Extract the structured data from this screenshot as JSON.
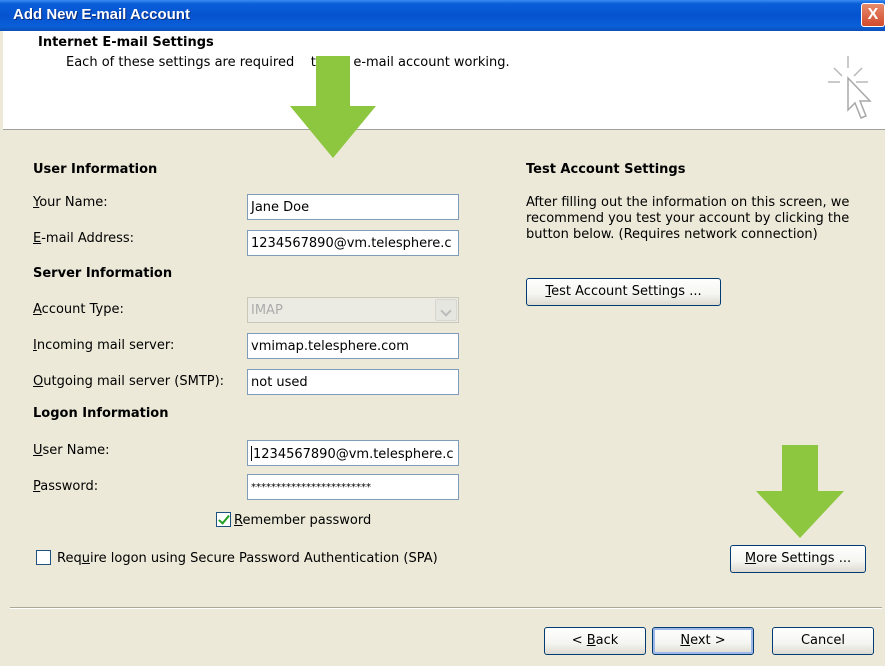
{
  "window": {
    "title": "Add New E-mail Account",
    "close_glyph": "X"
  },
  "header": {
    "title": "Internet E-mail Settings",
    "description": "Each of these settings are required    t your e-mail account working."
  },
  "user_info": {
    "heading": "User Information",
    "your_name_label": "our Name:",
    "your_name_label_key": "Y",
    "your_name_value": "Jane Doe",
    "email_label_key": "E",
    "email_label": "-mail Address:",
    "email_value": "1234567890@vm.telesphere.c"
  },
  "server_info": {
    "heading": "Server Information",
    "account_type_label_key": "A",
    "account_type_label": "ccount Type:",
    "account_type_value": "IMAP",
    "incoming_label_key": "I",
    "incoming_label": "ncoming mail server:",
    "incoming_value": "vmimap.telesphere.com",
    "outgoing_label_key": "O",
    "outgoing_label": "utgoing mail server (SMTP):",
    "outgoing_value": "not used"
  },
  "logon_info": {
    "heading": "Logon Information",
    "username_label_key": "U",
    "username_label": "ser Name:",
    "username_value": "1234567890@vm.telesphere.c",
    "password_label_key": "P",
    "password_label": "assword:",
    "password_value": "************************",
    "remember_label_key": "R",
    "remember_label": "emember password",
    "remember_checked": true,
    "spa_label_pre": "Req",
    "spa_label_key": "u",
    "spa_label_post": "ire logon using Secure Password Authentication (SPA)",
    "spa_checked": false
  },
  "test_settings": {
    "heading": "Test Account Settings",
    "description_line1": "After filling out the information on this screen, we",
    "description_line2": "recommend you test your account by clicking the",
    "description_line3": "button below. (Requires network connection)",
    "button_key": "T",
    "button_label": "est Account Settings ..."
  },
  "more_settings": {
    "button_key": "M",
    "button_label": "ore Settings ..."
  },
  "footer": {
    "back_prefix": "< ",
    "back_key": "B",
    "back_label": "ack",
    "next_key": "N",
    "next_label": "ext >",
    "cancel_label": "Cancel"
  },
  "colors": {
    "title_bar": "#0553d0",
    "dialog_bg": "#ece9d8",
    "annotation_arrow": "#8dc63f"
  },
  "icons": [
    "close-icon",
    "wizard-cursor-icon",
    "combo-dropdown-icon",
    "checkmark-icon",
    "annotation-arrow-icon"
  ]
}
